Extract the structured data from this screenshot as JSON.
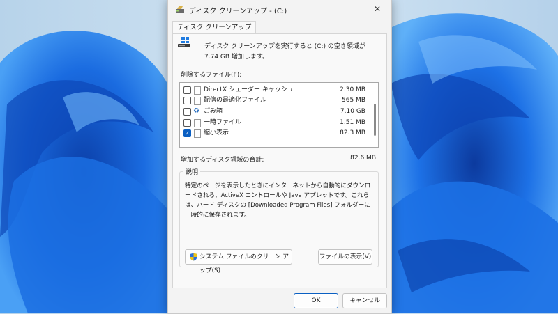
{
  "window": {
    "title": "ディスク クリーンアップ - (C:)",
    "close_symbol": "✕"
  },
  "tab": {
    "label": "ディスク クリーンアップ"
  },
  "intro_text": "ディスク クリーンアップを実行すると (C:) の空き領域が 7.74 GB 増加します。",
  "files_label": "削除するファイル(F):",
  "files": [
    {
      "name": "DirectX シェーダー キャッシュ",
      "size": "2.30 MB",
      "checked": false,
      "icon": "file-icon"
    },
    {
      "name": "配信の最適化ファイル",
      "size": "565 MB",
      "checked": false,
      "icon": "file-icon"
    },
    {
      "name": "ごみ箱",
      "size": "7.10 GB",
      "checked": false,
      "icon": "recycle-bin-icon"
    },
    {
      "name": "一時ファイル",
      "size": "1.51 MB",
      "checked": false,
      "icon": "file-icon"
    },
    {
      "name": "縮小表示",
      "size": "82.3 MB",
      "checked": true,
      "icon": "file-icon"
    }
  ],
  "total": {
    "label": "増加するディスク領域の合計:",
    "value": "82.6 MB"
  },
  "description": {
    "legend": "説明",
    "text": "特定のページを表示したときにインターネットから自動的にダウンロードされる、ActiveX コントロールや Java アプレットです。これらは、ハード ディスクの [Downloaded Program Files] フォルダーに一時的に保存されます。"
  },
  "buttons": {
    "system_cleanup": "システム ファイルのクリーン アップ(S)",
    "view_files": "ファイルの表示(V)",
    "ok": "OK",
    "cancel": "キャンセル"
  },
  "colors": {
    "accent": "#0a5fc2",
    "wallpaper_blue": "#1466d8"
  }
}
